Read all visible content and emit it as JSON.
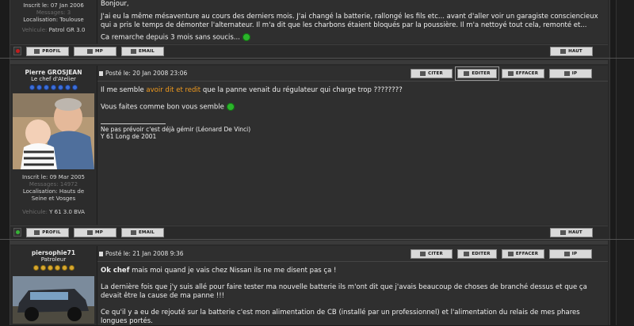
{
  "posts": [
    {
      "author": {
        "joined": "Inscrit le: 07 Jan 2006",
        "messages": "Messages: 3",
        "location": "Localisation: Toulouse",
        "vehicle_label": "Vehicule:",
        "vehicle": "Patrol GR 3.0"
      },
      "body": {
        "greeting": "Bonjour,",
        "p1": "J'ai eu la même mésaventure au cours des derniers mois. J'ai changé la batterie, rallongé les fils etc... avant d'aller voir un garagiste consciencieux qui a pris le temps de démonter l'alternateur. Il m'a dit que les charbons étaient bloqués par la poussière. Il m'a nettoyé tout cela, remonté et...",
        "p2": "Ca remarche depuis 3 mois sans soucis..."
      },
      "footer": {
        "profile": "PROFIL",
        "mp": "MP",
        "email": "EMAIL",
        "top": "HAUT"
      }
    },
    {
      "author": {
        "name": "Pierre GROSJEAN",
        "rank": "Le chef d'Atelier",
        "joined": "Inscrit le: 09 Mar 2005",
        "messages": "Messages: 14972",
        "location": "Localisation: Hauts de Seine et Vosges",
        "vehicle_label": "Vehicule:",
        "vehicle": "Y 61 3.0 BVA"
      },
      "posted": "Posté le: 20 Jan 2008 23:06",
      "buttons": {
        "quote": "CITER",
        "edit": "EDITER",
        "delete": "EFFACER",
        "ip": "IP"
      },
      "body": {
        "p1_pre": "Il me semble",
        "p1_link": "avoir dit et redit",
        "p1_post": "que la panne venait du régulateur qui charge trop ????????",
        "p2": "Vous faites comme bon vous semble",
        "sig1": "Ne pas prévoir c'est déjà gémir (Léonard De Vinci)",
        "sig2": "Y 61 Long de 2001"
      },
      "footer": {
        "profile": "PROFIL",
        "mp": "MP",
        "email": "EMAIL",
        "top": "HAUT"
      }
    },
    {
      "author": {
        "name": "piersophie71",
        "rank": "Patroleur"
      },
      "posted": "Posté le: 21 Jan 2008 9:36",
      "buttons": {
        "quote": "CITER",
        "edit": "EDITER",
        "delete": "EFFACER",
        "ip": "IP"
      },
      "body": {
        "p1_bold": "Ok chef",
        "p1_rest": "mais moi quand je vais chez Nissan ils ne me disent pas ça !",
        "p2": "La dernière fois que j'y suis allé pour faire tester ma nouvelle batterie ils m'ont dit que j'avais beaucoup de choses de branché dessus et que ça devait être la cause de ma panne !!!",
        "p3": "Ce qu'il y a eu de rejouté sur la batterie c'est mon alimentation de CB (installé par un professionnel) et l'alimentation du relais de mes phares longues portés."
      }
    }
  ]
}
